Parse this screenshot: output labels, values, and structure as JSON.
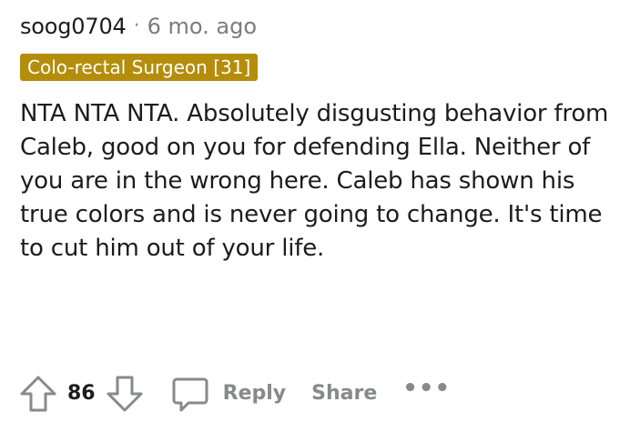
{
  "comment": {
    "username": "soog0704",
    "separator": "·",
    "timestamp": "6 mo. ago",
    "flair": "Colo-rectal Surgeon [31]",
    "body": "NTA NTA NTA. Absolutely disgusting behavior from Caleb, good on you for defending Ella. Neither of you are in the wrong here. Caleb has shown his true colors and is never going to change. It's time to cut him out of your life."
  },
  "actions": {
    "upvote_icon": "upvote-arrow-icon",
    "vote_count": "86",
    "downvote_icon": "downvote-arrow-icon",
    "reply_icon": "speech-bubble-icon",
    "reply_label": "Reply",
    "share_label": "Share",
    "more_label": "•••"
  },
  "colors": {
    "flair_background": "#b48d0b",
    "muted_text": "#878a8c",
    "primary_text": "#1c1c1c"
  }
}
